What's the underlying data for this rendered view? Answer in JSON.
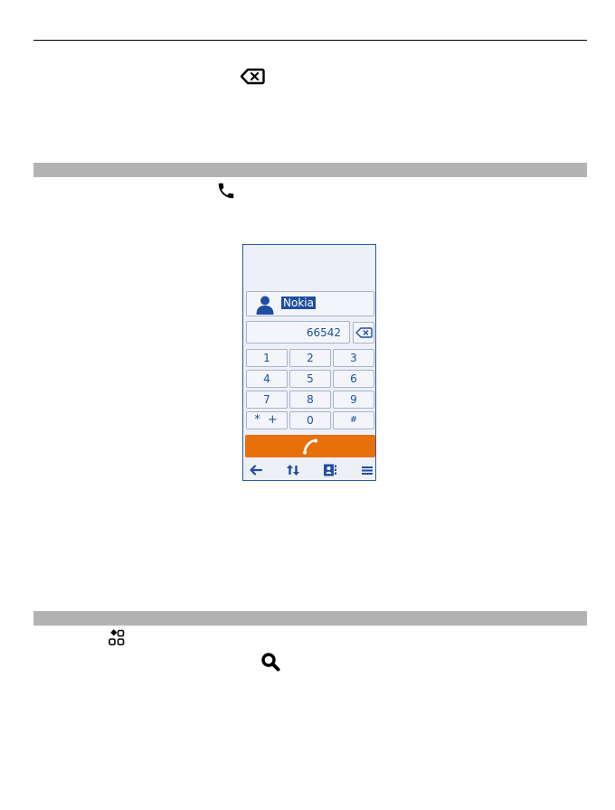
{
  "document": {
    "icons": [
      "backspace-icon",
      "call-icon",
      "apps-grid-icon",
      "search-icon"
    ],
    "section_bar_color": "#b3b3b3"
  },
  "phone": {
    "contact_name": "Nokia",
    "number": "66542",
    "keys": [
      "1",
      "2",
      "3",
      "4",
      "5",
      "6",
      "7",
      "8",
      "9",
      "* +",
      "0",
      "#"
    ],
    "call_button_color": "#e8700a",
    "accent_color": "#1f4e9e",
    "toolbar": [
      "back-arrow-icon",
      "call-log-icon",
      "contacts-icon",
      "menu-icon"
    ]
  }
}
